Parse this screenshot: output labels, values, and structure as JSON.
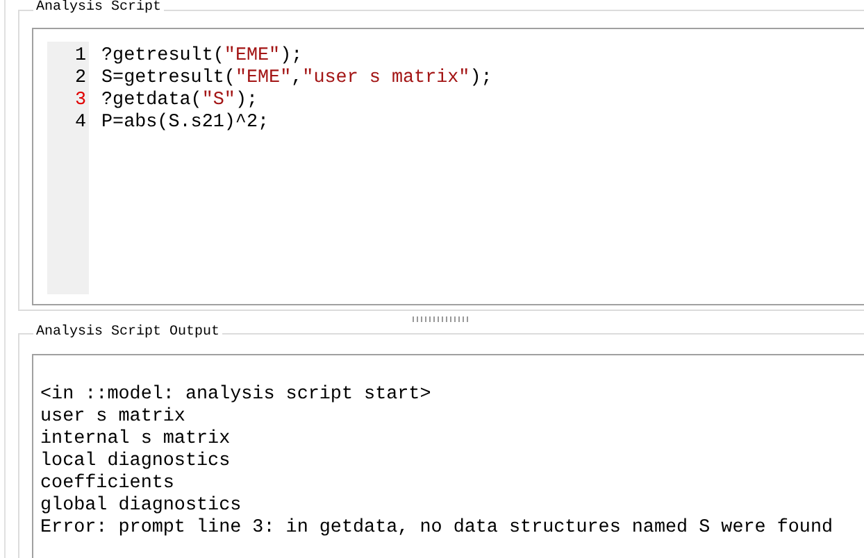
{
  "script_panel": {
    "title": "Analysis Script",
    "lines": [
      {
        "number": "1",
        "error": false,
        "tokens": [
          {
            "kind": "plain",
            "text": "?getresult("
          },
          {
            "kind": "string",
            "text": "\"EME\""
          },
          {
            "kind": "plain",
            "text": ");"
          }
        ]
      },
      {
        "number": "2",
        "error": false,
        "tokens": [
          {
            "kind": "plain",
            "text": "S=getresult("
          },
          {
            "kind": "string",
            "text": "\"EME\""
          },
          {
            "kind": "plain",
            "text": ","
          },
          {
            "kind": "string",
            "text": "\"user s matrix\""
          },
          {
            "kind": "plain",
            "text": ");"
          }
        ]
      },
      {
        "number": "3",
        "error": true,
        "tokens": [
          {
            "kind": "plain",
            "text": "?getdata("
          },
          {
            "kind": "string",
            "text": "\"S\""
          },
          {
            "kind": "plain",
            "text": ");"
          }
        ]
      },
      {
        "number": "4",
        "error": false,
        "tokens": [
          {
            "kind": "plain",
            "text": "P=abs(S.s21)^2;"
          }
        ]
      }
    ]
  },
  "output_panel": {
    "title": "Analysis Script Output",
    "lines": [
      "<in ::model: analysis script start>",
      "user s matrix",
      "internal s matrix",
      "local diagnostics",
      "coefficients",
      "global diagnostics",
      "Error: prompt line 3: in getdata, no data structures named S were found"
    ]
  }
}
